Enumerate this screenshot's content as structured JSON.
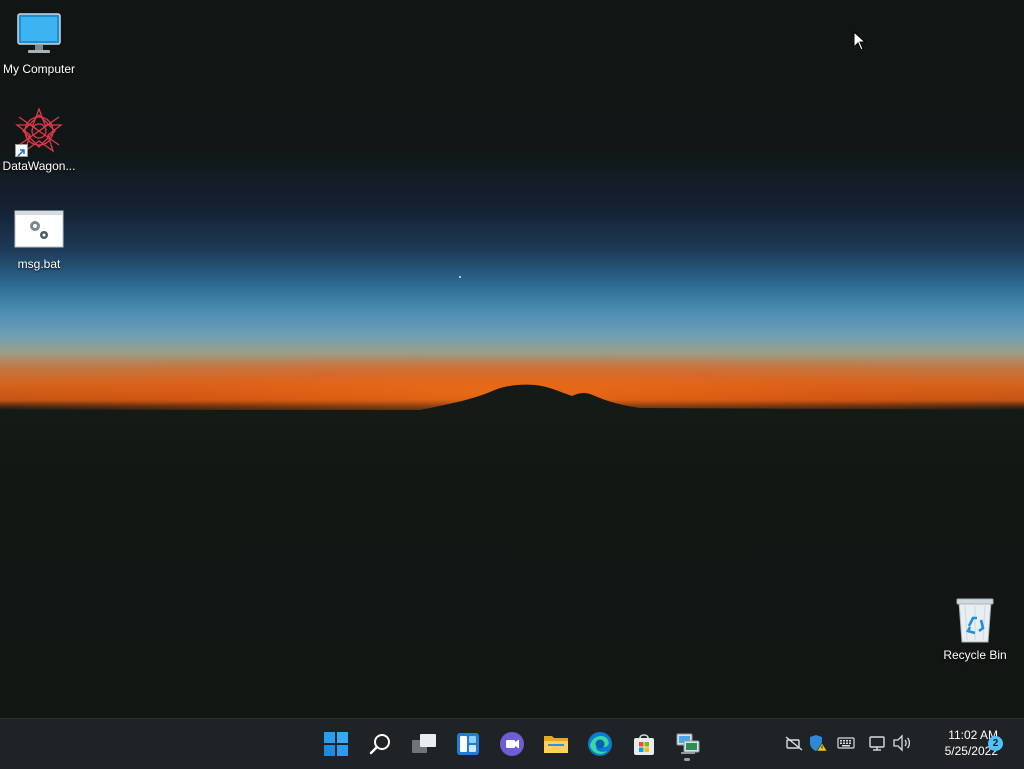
{
  "desktop": {
    "icons": [
      {
        "label": "My Computer",
        "icon": "monitor-icon"
      },
      {
        "label": "DataWagon...",
        "icon": "datawagon-app-icon"
      },
      {
        "label": "msg.bat",
        "icon": "batch-file-icon"
      },
      {
        "label": "Recycle Bin",
        "icon": "recycle-bin-icon"
      }
    ]
  },
  "taskbar": {
    "pinned": [
      {
        "name": "start",
        "icon": "windows-start-icon"
      },
      {
        "name": "search",
        "icon": "search-icon"
      },
      {
        "name": "task-view",
        "icon": "task-view-icon"
      },
      {
        "name": "widgets",
        "icon": "widgets-icon"
      },
      {
        "name": "chat",
        "icon": "teams-chat-icon"
      },
      {
        "name": "file-explorer",
        "icon": "folder-icon"
      },
      {
        "name": "edge",
        "icon": "edge-browser-icon"
      },
      {
        "name": "store",
        "icon": "store-bag-icon"
      },
      {
        "name": "network-app",
        "icon": "network-computer-icon",
        "running": true
      }
    ],
    "tray": {
      "icons": [
        "network-disconnected-icon",
        "security-warning-icon",
        "keyboard-icon",
        "display-network-icon",
        "volume-icon"
      ],
      "time": "11:02 AM",
      "date": "5/25/2022",
      "notification_count": "2"
    }
  },
  "colors": {
    "taskbar_bg": "#1f2326",
    "accent": "#4cc2ff",
    "windows_blue": "#2d9bf0"
  }
}
